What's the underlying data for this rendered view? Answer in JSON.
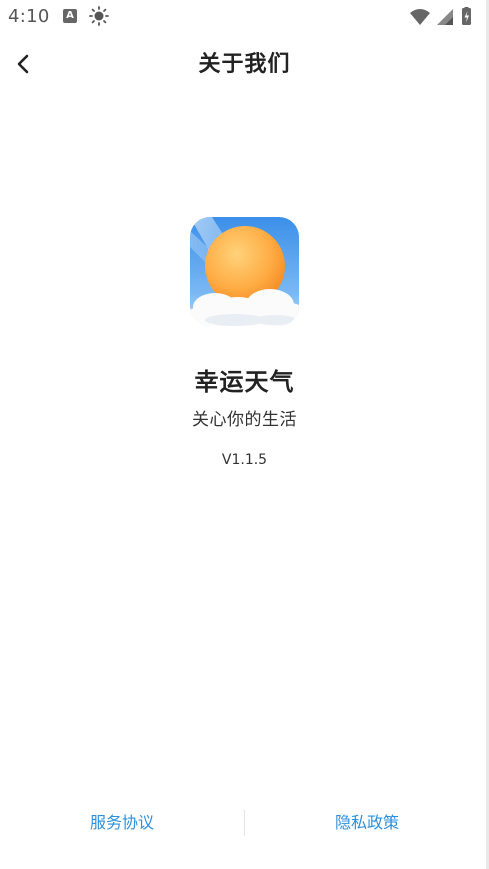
{
  "status_bar": {
    "time": "4:10",
    "notification_icon_letter": "A",
    "icons": [
      "a-notification-icon",
      "sun-icon",
      "wifi-icon",
      "cell-signal-icon",
      "battery-icon"
    ]
  },
  "header": {
    "title": "关于我们",
    "back_icon": "chevron-left-icon"
  },
  "app": {
    "name": "幸运天气",
    "slogan": "关心你的生活",
    "version": "V1.1.5",
    "logo_icon": "sun-cloud-icon"
  },
  "footer": {
    "service_agreement": "服务协议",
    "privacy_policy": "隐私政策"
  },
  "colors": {
    "link": "#2f8fdd",
    "logo_sky_top": "#3a8ee8",
    "logo_sun": "#ffb347"
  }
}
